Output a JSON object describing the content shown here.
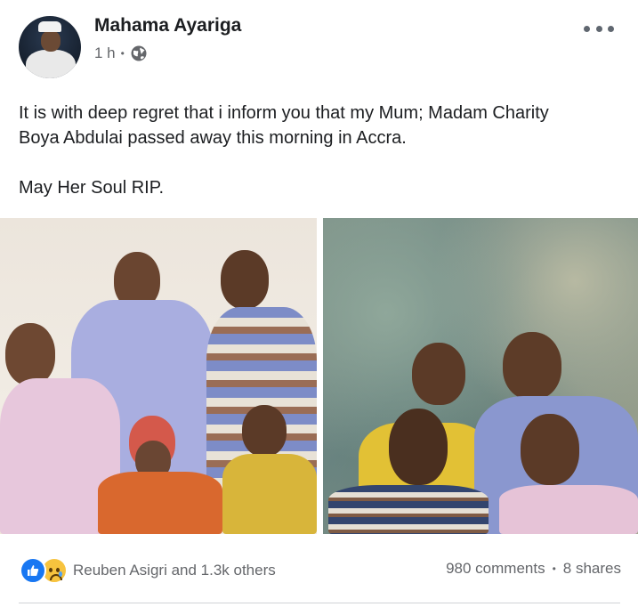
{
  "post": {
    "author": "Mahama Ayariga",
    "time": "1 h",
    "visibility_icon": "globe-icon",
    "text_lines": [
      "It is with deep regret that i inform you that my Mum; Madam Charity",
      "Boya Abdulai passed away this morning in Accra."
    ],
    "text_closing": "May Her Soul RIP."
  },
  "photos": [
    "family-photo-left",
    "family-photo-right"
  ],
  "footer": {
    "reaction_icons": [
      "like-icon",
      "sad-icon"
    ],
    "reactions_text": "Reuben Asigri and 1.3k others",
    "comments": "980 comments",
    "shares": "8 shares"
  },
  "colors": {
    "accent": "#1877f2",
    "secondary_text": "#65676b",
    "primary_text": "#1c1e21"
  }
}
